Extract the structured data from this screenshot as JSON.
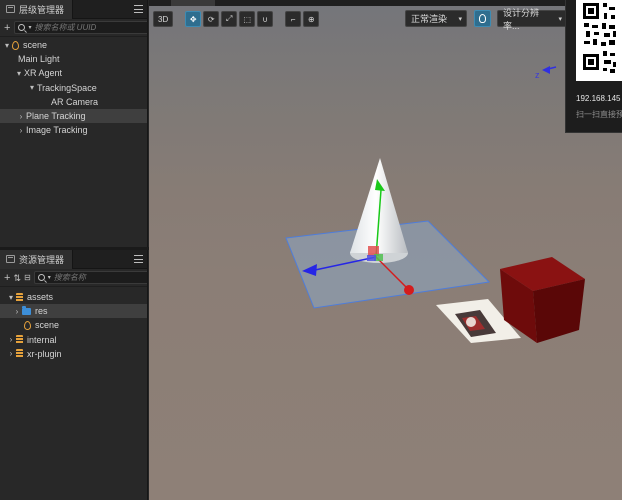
{
  "hierarchy": {
    "tab_title": "层级管理器",
    "search_placeholder": "搜索名称或 UUID",
    "nodes": [
      {
        "label": "scene",
        "icon": "scene-icon"
      },
      {
        "label": "Main Light"
      },
      {
        "label": "XR Agent"
      },
      {
        "label": "TrackingSpace"
      },
      {
        "label": "AR Camera"
      },
      {
        "label": "Plane Tracking",
        "selected": true
      },
      {
        "label": "Image Tracking"
      }
    ]
  },
  "assets": {
    "tab_title": "资源管理器",
    "search_placeholder": "搜索名称",
    "nodes": [
      {
        "label": "assets",
        "icon": "database-icon"
      },
      {
        "label": "res",
        "icon": "folder-icon",
        "selected": true
      },
      {
        "label": "scene",
        "icon": "scene-icon"
      },
      {
        "label": "internal",
        "icon": "database-icon"
      },
      {
        "label": "xr-plugin",
        "icon": "database-icon"
      }
    ]
  },
  "scene_toolbar": {
    "mode_3d": "3D",
    "render_mode": "正常渲染",
    "resolution": "设计分辨率..."
  },
  "gizmo": {
    "axis_z_label": "z"
  },
  "qr_popup": {
    "ip_text": "192.168.145",
    "hint_text": "扫一扫直接预"
  },
  "colors": {
    "selection": "#3f3f3f",
    "accent": "#2f6e8f",
    "cube": "#6e0b0b"
  }
}
